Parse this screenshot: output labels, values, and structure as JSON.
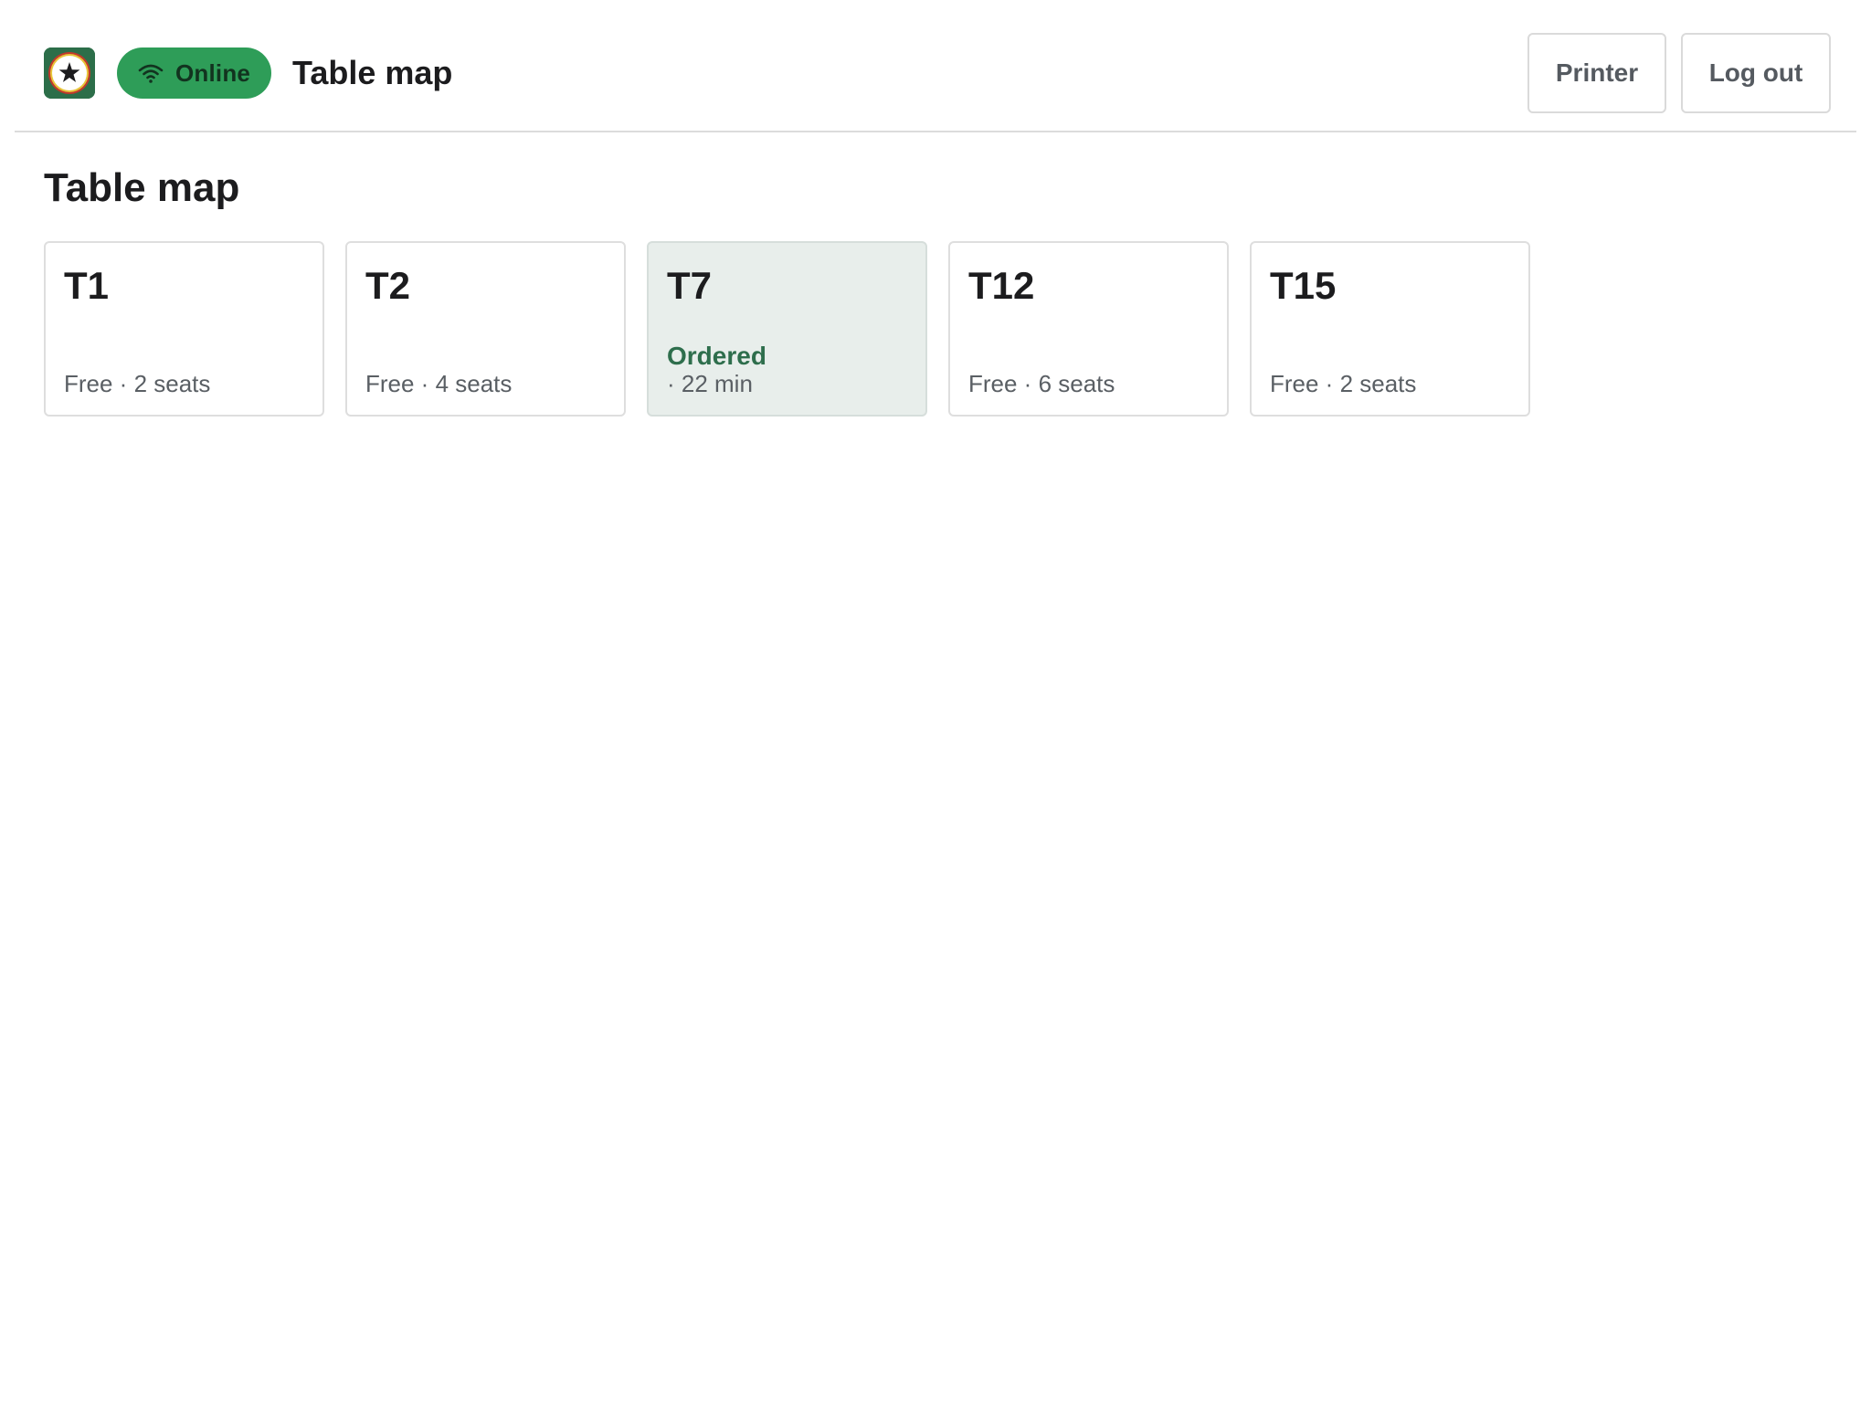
{
  "header": {
    "logo_icon": "star-badge-icon",
    "connection_status": "Online",
    "connection_icon": "wifi-icon",
    "status_color": "#2e9d58",
    "title": "Table map",
    "printer_label": "Printer",
    "logout_label": "Log out"
  },
  "main": {
    "title": "Table map",
    "tables": [
      {
        "name": "T1",
        "status": "Free",
        "detail": "Free · 2 seats"
      },
      {
        "name": "T2",
        "status": "Free",
        "detail": "Free · 4 seats"
      },
      {
        "name": "T7",
        "status": "Ordered",
        "detail": "· 22 min",
        "highlight_color": "#2e6e4c"
      },
      {
        "name": "T12",
        "status": "Free",
        "detail": "Free · 6 seats"
      },
      {
        "name": "T15",
        "status": "Free",
        "detail": "Free · 2 seats"
      }
    ]
  }
}
